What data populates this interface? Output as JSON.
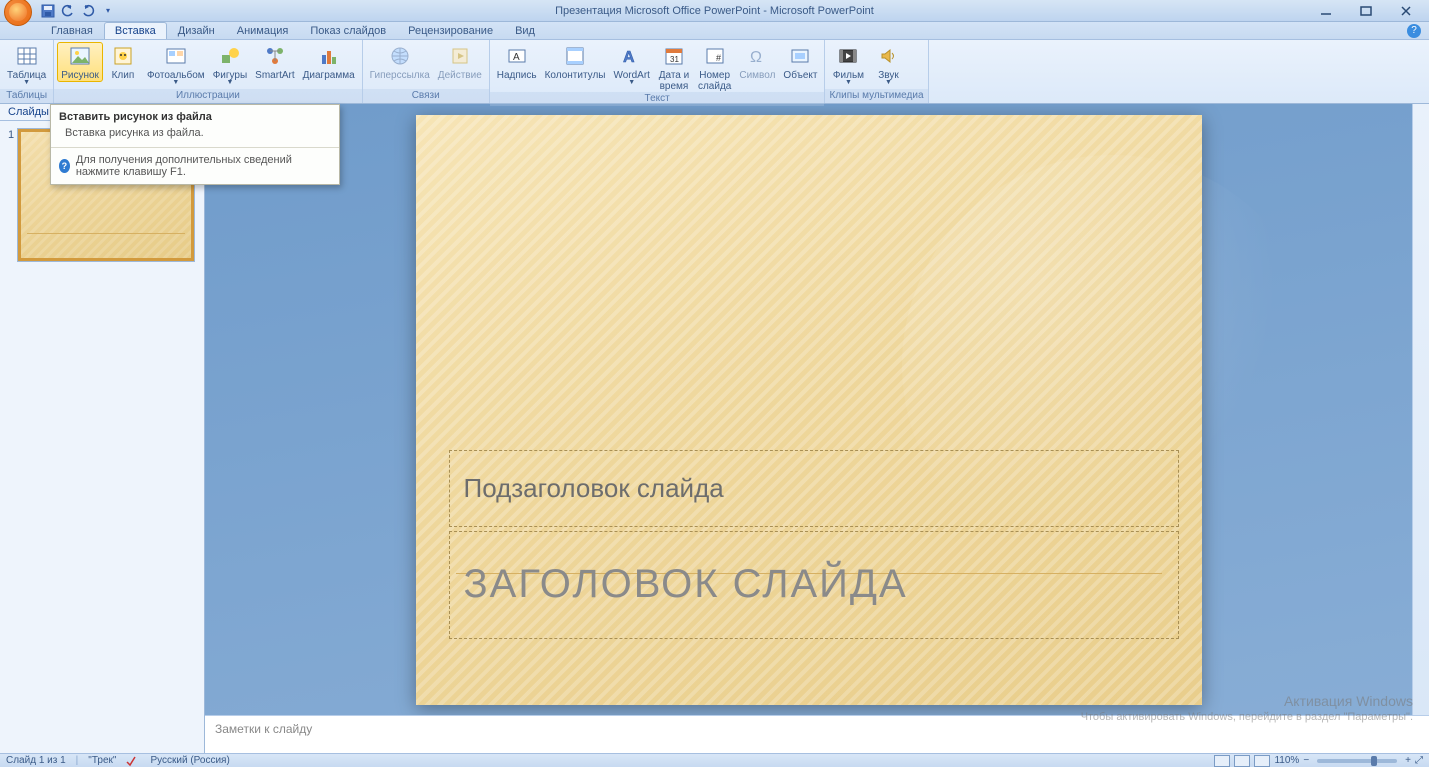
{
  "title": "Презентация Microsoft Office PowerPoint - Microsoft PowerPoint",
  "qat": {
    "dropdown": "▾"
  },
  "tabs": {
    "items": [
      "Главная",
      "Вставка",
      "Дизайн",
      "Анимация",
      "Показ слайдов",
      "Рецензирование",
      "Вид"
    ],
    "active_index": 1
  },
  "ribbon": {
    "groups": [
      {
        "label": "Таблицы",
        "items": [
          {
            "name": "table-button",
            "label": "Таблица",
            "dd": true
          }
        ]
      },
      {
        "label": "Иллюстрации",
        "items": [
          {
            "name": "picture-button",
            "label": "Рисунок",
            "highlight": true
          },
          {
            "name": "clip-button",
            "label": "Клип"
          },
          {
            "name": "photoalbum-button",
            "label": "Фотоальбом",
            "dd": true
          },
          {
            "name": "shapes-button",
            "label": "Фигуры",
            "dd": true
          },
          {
            "name": "smartart-button",
            "label": "SmartArt"
          },
          {
            "name": "chart-button",
            "label": "Диаграмма"
          }
        ]
      },
      {
        "label": "Связи",
        "items": [
          {
            "name": "hyperlink-button",
            "label": "Гиперссылка",
            "disabled": true
          },
          {
            "name": "action-button",
            "label": "Действие",
            "disabled": true
          }
        ]
      },
      {
        "label": "Текст",
        "items": [
          {
            "name": "textbox-button",
            "label": "Надпись"
          },
          {
            "name": "headerfooter-button",
            "label": "Колонтитулы"
          },
          {
            "name": "wordart-button",
            "label": "WordArt",
            "dd": true
          },
          {
            "name": "datetime-button",
            "label": "Дата и\nвремя"
          },
          {
            "name": "slidenumber-button",
            "label": "Номер\nслайда"
          },
          {
            "name": "symbol-button",
            "label": "Символ",
            "disabled": true
          },
          {
            "name": "object-button",
            "label": "Объект"
          }
        ]
      },
      {
        "label": "Клипы мультимедиа",
        "items": [
          {
            "name": "movie-button",
            "label": "Фильм",
            "dd": true
          },
          {
            "name": "sound-button",
            "label": "Звук",
            "dd": true
          }
        ]
      }
    ]
  },
  "tooltip": {
    "title": "Вставить рисунок из файла",
    "body": "Вставка рисунка из файла.",
    "help": "Для получения дополнительных сведений нажмите клавишу F1."
  },
  "pane": {
    "tab_slides": "Слайды",
    "close": "×",
    "thumb_number": "1"
  },
  "slide": {
    "subtitle": "Подзаголовок слайда",
    "title": "ЗАГОЛОВОК СЛАЙДА"
  },
  "notes": {
    "placeholder": "Заметки к слайду"
  },
  "watermark": {
    "line1": "Активация Windows",
    "line2": "Чтобы активировать Windows, перейдите в раздел \"Параметры\"."
  },
  "status": {
    "slide_pos": "Слайд 1 из 1",
    "theme": "\"Трек\"",
    "lang": "Русский (Россия)",
    "zoom": "110%",
    "fit": "⤢"
  }
}
